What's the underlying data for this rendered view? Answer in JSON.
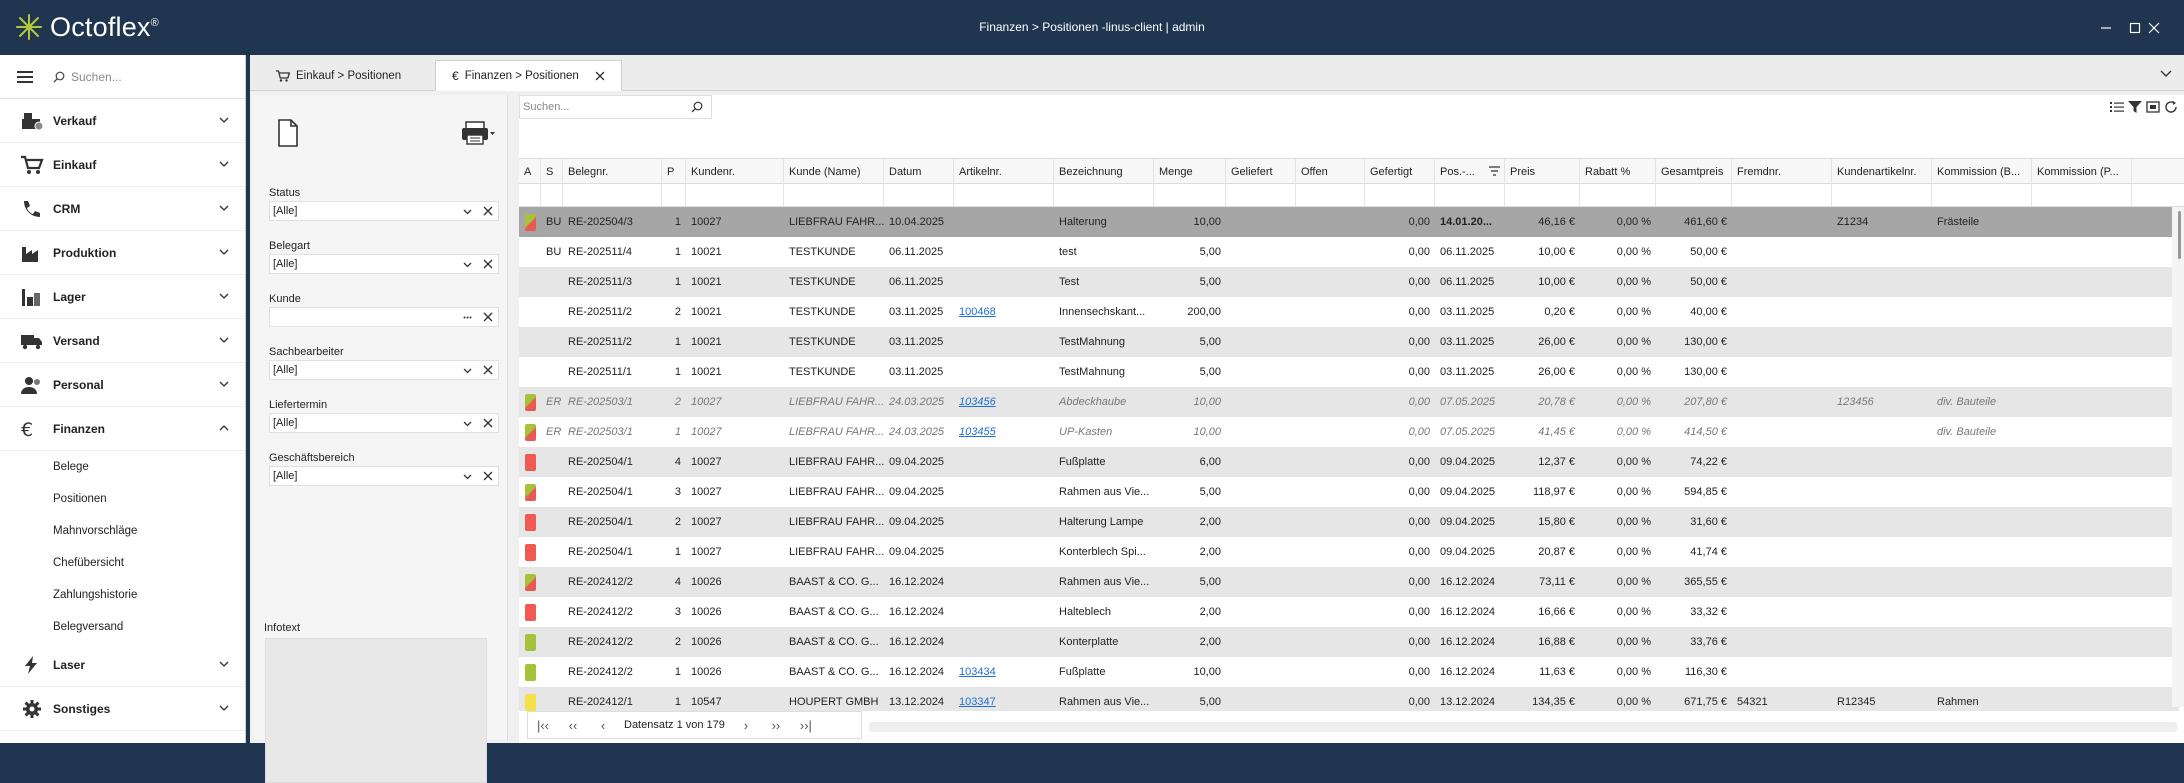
{
  "window": {
    "app_name": "Octoflex",
    "trademark": "®",
    "title": "Finanzen > Positionen -linus-client | admin"
  },
  "sidebar": {
    "search_placeholder": "Suchen...",
    "sections": [
      {
        "label": "Verkauf",
        "icon": "cash-register-icon"
      },
      {
        "label": "Einkauf",
        "icon": "cart-icon"
      },
      {
        "label": "CRM",
        "icon": "phone-icon"
      },
      {
        "label": "Produktion",
        "icon": "factory-icon"
      },
      {
        "label": "Lager",
        "icon": "warehouse-icon"
      },
      {
        "label": "Versand",
        "icon": "truck-icon"
      },
      {
        "label": "Personal",
        "icon": "people-icon"
      },
      {
        "label": "Finanzen",
        "icon": "euro-icon"
      },
      {
        "label": "Laser",
        "icon": "lightning-icon"
      },
      {
        "label": "Sonstiges",
        "icon": "gear-icon"
      }
    ],
    "finanzen_items": [
      "Belege",
      "Positionen",
      "Mahnvorschläge",
      "Chefübersicht",
      "Zahlungshistorie",
      "Belegversand"
    ]
  },
  "tabs": [
    {
      "label": "Einkauf > Positionen",
      "icon": "cart-icon"
    },
    {
      "label": "Finanzen > Positionen",
      "icon": "euro-icon"
    }
  ],
  "filters": {
    "status_label": "Status",
    "status_value": "[Alle]",
    "belegart_label": "Belegart",
    "belegart_value": "[Alle]",
    "kunde_label": "Kunde",
    "kunde_value": "",
    "sachbearbeiter_label": "Sachbearbeiter",
    "sachbearbeiter_value": "[Alle]",
    "liefertermin_label": "Liefertermin",
    "liefertermin_value": "[Alle]",
    "geschaeftsbereich_label": "Geschäftsbereich",
    "geschaeftsbereich_value": "[Alle]",
    "infotext_label": "Infotext"
  },
  "grid": {
    "search_placeholder": "Suchen...",
    "columns": [
      "A",
      "S",
      "Belegnr.",
      "P",
      "Kundenr.",
      "Kunde (Name)",
      "Datum",
      "Artikelnr.",
      "Bezeichnung",
      "Menge",
      "Geliefert",
      "Offen",
      "Gefertigt",
      "Pos.-...",
      "Preis",
      "Rabatt %",
      "Gesamtpreis",
      "Fremdnr.",
      "Kundenartikelnr.",
      "Kommission (B...",
      "Kommission (P..."
    ],
    "rows": [
      {
        "a": "#e85a4f/#a6c13a",
        "s": "BU",
        "belegnr": "RE-202504/3",
        "p": "1",
        "kundenr": "10027",
        "kunde": "LIEBFRAU FAHR...",
        "datum": "10.04.2025",
        "artikelnr": "",
        "bezeichnung": "Halterung",
        "menge": "10,00",
        "geliefert": "",
        "offen": "",
        "gefertigt": "0,00",
        "pos": "14.01.20...",
        "preis": "46,16 €",
        "rabatt": "0,00 %",
        "gesamt": "461,60 €",
        "fremdnr": "",
        "kundenart": "Z1234",
        "kommb": "Frästeile",
        "kommp": "",
        "style": "sel"
      },
      {
        "a": "",
        "s": "BU",
        "belegnr": "RE-202511/4",
        "p": "1",
        "kundenr": "10021",
        "kunde": "TESTKUNDE",
        "datum": "06.11.2025",
        "artikelnr": "",
        "bezeichnung": "test",
        "menge": "5,00",
        "geliefert": "",
        "offen": "",
        "gefertigt": "0,00",
        "pos": "06.11.2025",
        "preis": "10,00 €",
        "rabatt": "0,00 %",
        "gesamt": "50,00 €",
        "fremdnr": "",
        "kundenart": "",
        "kommb": "",
        "kommp": "",
        "style": ""
      },
      {
        "a": "",
        "s": "",
        "belegnr": "RE-202511/3",
        "p": "1",
        "kundenr": "10021",
        "kunde": "TESTKUNDE",
        "datum": "06.11.2025",
        "artikelnr": "",
        "bezeichnung": "Test",
        "menge": "5,00",
        "geliefert": "",
        "offen": "",
        "gefertigt": "0,00",
        "pos": "06.11.2025",
        "preis": "10,00 €",
        "rabatt": "0,00 %",
        "gesamt": "50,00 €",
        "fremdnr": "",
        "kundenart": "",
        "kommb": "",
        "kommp": "",
        "style": "alt"
      },
      {
        "a": "",
        "s": "",
        "belegnr": "RE-202511/2",
        "p": "2",
        "kundenr": "10021",
        "kunde": "TESTKUNDE",
        "datum": "03.11.2025",
        "artikelnr": "100468",
        "bezeichnung": "Innensechskant...",
        "menge": "200,00",
        "geliefert": "",
        "offen": "",
        "gefertigt": "0,00",
        "pos": "03.11.2025",
        "preis": "0,20 €",
        "rabatt": "0,00 %",
        "gesamt": "40,00 €",
        "fremdnr": "",
        "kundenart": "",
        "kommb": "",
        "kommp": "",
        "style": ""
      },
      {
        "a": "",
        "s": "",
        "belegnr": "RE-202511/2",
        "p": "1",
        "kundenr": "10021",
        "kunde": "TESTKUNDE",
        "datum": "03.11.2025",
        "artikelnr": "",
        "bezeichnung": "TestMahnung",
        "menge": "5,00",
        "geliefert": "",
        "offen": "",
        "gefertigt": "0,00",
        "pos": "03.11.2025",
        "preis": "26,00 €",
        "rabatt": "0,00 %",
        "gesamt": "130,00 €",
        "fremdnr": "",
        "kundenart": "",
        "kommb": "",
        "kommp": "",
        "style": "alt"
      },
      {
        "a": "",
        "s": "",
        "belegnr": "RE-202511/1",
        "p": "1",
        "kundenr": "10021",
        "kunde": "TESTKUNDE",
        "datum": "03.11.2025",
        "artikelnr": "",
        "bezeichnung": "TestMahnung",
        "menge": "5,00",
        "geliefert": "",
        "offen": "",
        "gefertigt": "0,00",
        "pos": "03.11.2025",
        "preis": "26,00 €",
        "rabatt": "0,00 %",
        "gesamt": "130,00 €",
        "fremdnr": "",
        "kundenart": "",
        "kommb": "",
        "kommp": "",
        "style": ""
      },
      {
        "a": "#e85a4f/#a6c13a",
        "s": "ER",
        "belegnr": "RE-202503/1",
        "p": "2",
        "kundenr": "10027",
        "kunde": "LIEBFRAU FAHR...",
        "datum": "24.03.2025",
        "artikelnr": "103456",
        "bezeichnung": "Abdeckhaube",
        "menge": "10,00",
        "geliefert": "",
        "offen": "",
        "gefertigt": "0,00",
        "pos": "07.05.2025",
        "preis": "20,78 €",
        "rabatt": "0,00 %",
        "gesamt": "207,80 €",
        "fremdnr": "",
        "kundenart": "123456",
        "kommb": "div. Bauteile",
        "kommp": "",
        "style": "alt it"
      },
      {
        "a": "#e85a4f/#a6c13a",
        "s": "ER",
        "belegnr": "RE-202503/1",
        "p": "1",
        "kundenr": "10027",
        "kunde": "LIEBFRAU FAHR...",
        "datum": "24.03.2025",
        "artikelnr": "103455",
        "bezeichnung": "UP-Kasten",
        "menge": "10,00",
        "geliefert": "",
        "offen": "",
        "gefertigt": "0,00",
        "pos": "07.05.2025",
        "preis": "41,45 €",
        "rabatt": "0,00 %",
        "gesamt": "414,50 €",
        "fremdnr": "",
        "kundenart": "",
        "kommb": "div. Bauteile",
        "kommp": "",
        "style": "it"
      },
      {
        "a": "#f05a52",
        "s": "",
        "belegnr": "RE-202504/1",
        "p": "4",
        "kundenr": "10027",
        "kunde": "LIEBFRAU FAHR...",
        "datum": "09.04.2025",
        "artikelnr": "",
        "bezeichnung": "Fußplatte",
        "menge": "6,00",
        "geliefert": "",
        "offen": "",
        "gefertigt": "0,00",
        "pos": "09.04.2025",
        "preis": "12,37 €",
        "rabatt": "0,00 %",
        "gesamt": "74,22 €",
        "fremdnr": "",
        "kundenart": "",
        "kommb": "",
        "kommp": "",
        "style": "alt"
      },
      {
        "a": "#e85a4f/#a6c13a",
        "s": "",
        "belegnr": "RE-202504/1",
        "p": "3",
        "kundenr": "10027",
        "kunde": "LIEBFRAU FAHR...",
        "datum": "09.04.2025",
        "artikelnr": "",
        "bezeichnung": "Rahmen aus Vie...",
        "menge": "5,00",
        "geliefert": "",
        "offen": "",
        "gefertigt": "0,00",
        "pos": "09.04.2025",
        "preis": "118,97 €",
        "rabatt": "0,00 %",
        "gesamt": "594,85 €",
        "fremdnr": "",
        "kundenart": "",
        "kommb": "",
        "kommp": "",
        "style": ""
      },
      {
        "a": "#f05a52",
        "s": "",
        "belegnr": "RE-202504/1",
        "p": "2",
        "kundenr": "10027",
        "kunde": "LIEBFRAU FAHR...",
        "datum": "09.04.2025",
        "artikelnr": "",
        "bezeichnung": "Halterung Lampe",
        "menge": "2,00",
        "geliefert": "",
        "offen": "",
        "gefertigt": "0,00",
        "pos": "09.04.2025",
        "preis": "15,80 €",
        "rabatt": "0,00 %",
        "gesamt": "31,60 €",
        "fremdnr": "",
        "kundenart": "",
        "kommb": "",
        "kommp": "",
        "style": "alt"
      },
      {
        "a": "#f05a52",
        "s": "",
        "belegnr": "RE-202504/1",
        "p": "1",
        "kundenr": "10027",
        "kunde": "LIEBFRAU FAHR...",
        "datum": "09.04.2025",
        "artikelnr": "",
        "bezeichnung": "Konterblech Spi...",
        "menge": "2,00",
        "geliefert": "",
        "offen": "",
        "gefertigt": "0,00",
        "pos": "09.04.2025",
        "preis": "20,87 €",
        "rabatt": "0,00 %",
        "gesamt": "41,74 €",
        "fremdnr": "",
        "kundenart": "",
        "kommb": "",
        "kommp": "",
        "style": ""
      },
      {
        "a": "#e85a4f/#a6c13a",
        "s": "",
        "belegnr": "RE-202412/2",
        "p": "4",
        "kundenr": "10026",
        "kunde": "BAAST & CO. G...",
        "datum": "16.12.2024",
        "artikelnr": "",
        "bezeichnung": "Rahmen aus Vie...",
        "menge": "5,00",
        "geliefert": "",
        "offen": "",
        "gefertigt": "0,00",
        "pos": "16.12.2024",
        "preis": "73,11 €",
        "rabatt": "0,00 %",
        "gesamt": "365,55 €",
        "fremdnr": "",
        "kundenart": "",
        "kommb": "",
        "kommp": "",
        "style": "alt"
      },
      {
        "a": "#f05a52",
        "s": "",
        "belegnr": "RE-202412/2",
        "p": "3",
        "kundenr": "10026",
        "kunde": "BAAST & CO. G...",
        "datum": "16.12.2024",
        "artikelnr": "",
        "bezeichnung": "Halteblech",
        "menge": "2,00",
        "geliefert": "",
        "offen": "",
        "gefertigt": "0,00",
        "pos": "16.12.2024",
        "preis": "16,66 €",
        "rabatt": "0,00 %",
        "gesamt": "33,32 €",
        "fremdnr": "",
        "kundenart": "",
        "kommb": "",
        "kommp": "",
        "style": ""
      },
      {
        "a": "#a6c13a",
        "s": "",
        "belegnr": "RE-202412/2",
        "p": "2",
        "kundenr": "10026",
        "kunde": "BAAST & CO. G...",
        "datum": "16.12.2024",
        "artikelnr": "",
        "bezeichnung": "Konterplatte",
        "menge": "2,00",
        "geliefert": "",
        "offen": "",
        "gefertigt": "0,00",
        "pos": "16.12.2024",
        "preis": "16,88 €",
        "rabatt": "0,00 %",
        "gesamt": "33,76 €",
        "fremdnr": "",
        "kundenart": "",
        "kommb": "",
        "kommp": "",
        "style": "alt"
      },
      {
        "a": "#a6c13a",
        "s": "",
        "belegnr": "RE-202412/2",
        "p": "1",
        "kundenr": "10026",
        "kunde": "BAAST & CO. G...",
        "datum": "16.12.2024",
        "artikelnr": "103434",
        "bezeichnung": "Fußplatte",
        "menge": "10,00",
        "geliefert": "",
        "offen": "",
        "gefertigt": "0,00",
        "pos": "16.12.2024",
        "preis": "11,63 €",
        "rabatt": "0,00 %",
        "gesamt": "116,30 €",
        "fremdnr": "",
        "kundenart": "",
        "kommb": "",
        "kommp": "",
        "style": ""
      },
      {
        "a": "#f5e04a",
        "s": "",
        "belegnr": "RE-202412/1",
        "p": "1",
        "kundenr": "10547",
        "kunde": "HOUPERT GMBH",
        "datum": "13.12.2024",
        "artikelnr": "103347",
        "bezeichnung": "Rahmen aus Vie...",
        "menge": "5,00",
        "geliefert": "",
        "offen": "",
        "gefertigt": "0,00",
        "pos": "13.12.2024",
        "preis": "134,35 €",
        "rabatt": "0,00 %",
        "gesamt": "671,75 €",
        "fremdnr": "54321",
        "kundenart": "R12345",
        "kommb": "Rahmen",
        "kommp": "",
        "style": "alt"
      }
    ],
    "pager_text": "Datensatz 1 von 179"
  }
}
